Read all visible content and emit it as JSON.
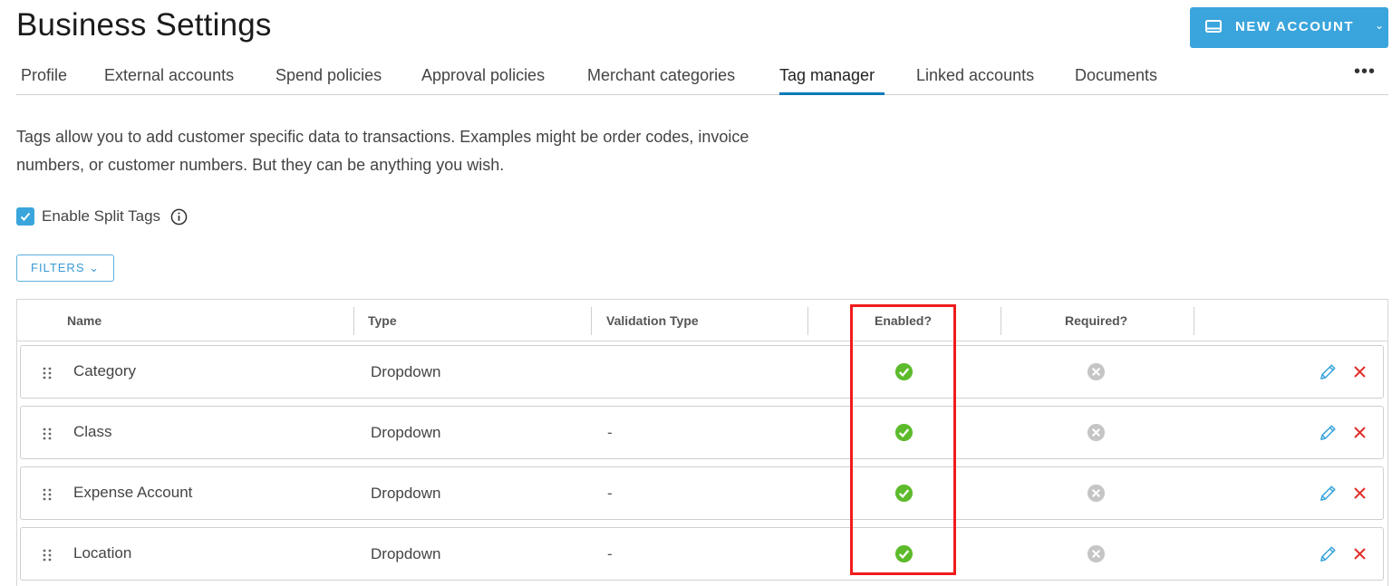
{
  "page": {
    "title": "Business Settings"
  },
  "header_button": {
    "label": "NEW ACCOUNT",
    "icon": "monitor-icon",
    "caret": "⌄"
  },
  "tabs": [
    {
      "label": "Profile"
    },
    {
      "label": "External accounts"
    },
    {
      "label": "Spend policies"
    },
    {
      "label": "Approval policies"
    },
    {
      "label": "Merchant categories"
    },
    {
      "label": "Tag manager",
      "active": true
    },
    {
      "label": "Linked accounts"
    },
    {
      "label": "Documents"
    }
  ],
  "tabs_more": "•••",
  "description": "Tags allow you to add customer specific data to transactions. Examples might be order codes, invoice numbers, or customer numbers. But they can be anything you wish.",
  "split_tags": {
    "label": "Enable Split Tags",
    "checked": true,
    "info_icon": "info-icon"
  },
  "filters": {
    "label": "FILTERS ⌄"
  },
  "table": {
    "columns": [
      "Name",
      "Type",
      "Validation Type",
      "Enabled?",
      "Required?"
    ],
    "rows": [
      {
        "name": "Category",
        "type": "Dropdown",
        "validation": "",
        "enabled": true,
        "required": false
      },
      {
        "name": "Class",
        "type": "Dropdown",
        "validation": "-",
        "enabled": true,
        "required": false
      },
      {
        "name": "Expense Account",
        "type": "Dropdown",
        "validation": "-",
        "enabled": true,
        "required": false
      },
      {
        "name": "Location",
        "type": "Dropdown",
        "validation": "-",
        "enabled": true,
        "required": false
      }
    ]
  },
  "colors": {
    "accent": "#3aa5dc",
    "tab_underline": "#0079b8",
    "enabled_green": "#5dbb2b",
    "required_gray": "#c5c5c5",
    "edit_blue": "#3aa5dc",
    "delete_red": "#e0302b",
    "highlight_red": "#f01c1c"
  }
}
